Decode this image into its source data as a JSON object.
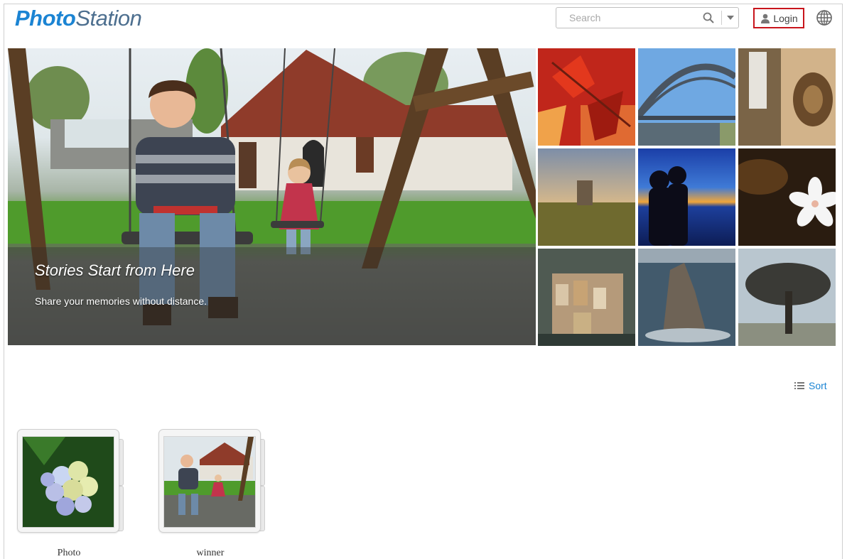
{
  "header": {
    "logo_part1": "Photo",
    "logo_part2": "Station",
    "search_placeholder": "Search",
    "login_label": "Login",
    "icons": [
      "search-icon",
      "chevron-down-icon",
      "user-icon",
      "globe-icon"
    ]
  },
  "hero": {
    "title": "Stories Start from Here",
    "subtitle": "Share your memories without distance."
  },
  "toolbar": {
    "sort_label": "Sort",
    "sort_icon": "list-icon"
  },
  "albums": [
    {
      "name": "Photo"
    },
    {
      "name": "winner"
    }
  ],
  "colors": {
    "brand_blue": "#1b84d3",
    "login_border": "#c8151c"
  }
}
